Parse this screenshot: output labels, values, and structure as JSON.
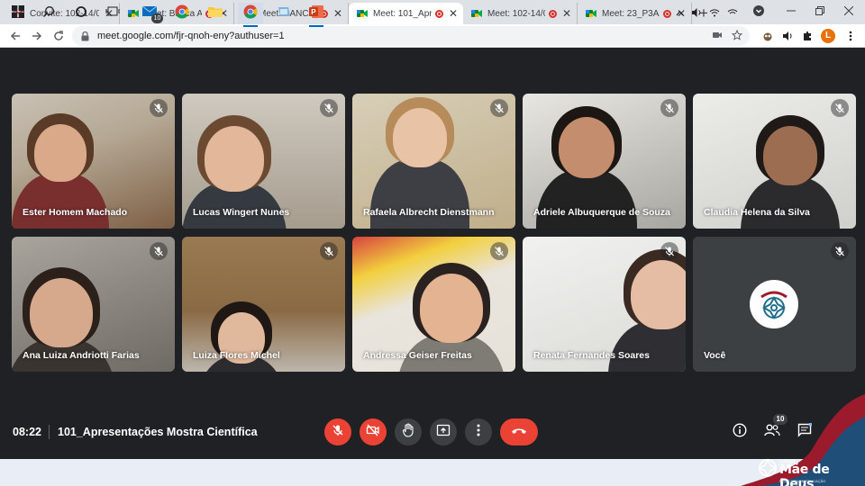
{
  "browser": {
    "tabs": [
      {
        "title": "Convite: 102-14/08",
        "favicon": "gmail-icon",
        "recording": false
      },
      {
        "title": "Meet: Banca Av",
        "favicon": "meet-icon",
        "recording": true
      },
      {
        "title": "Meet: BANCA_/",
        "favicon": "meet-icon",
        "recording": true
      },
      {
        "title": "Meet: 101_Apre",
        "favicon": "meet-icon",
        "recording": true,
        "active": true
      },
      {
        "title": "Meet: 102-14/0",
        "favicon": "meet-icon",
        "recording": true
      },
      {
        "title": "Meet: 23_P3A2",
        "favicon": "meet-icon",
        "recording": true
      }
    ],
    "url": "meet.google.com/fjr-qnoh-eny?authuser=1",
    "profile_initial": "L",
    "colors": {
      "profile": "#e8710a",
      "recording": "#d93025"
    }
  },
  "meet": {
    "participants": [
      {
        "name": "Ester Homem Machado",
        "muted": true
      },
      {
        "name": "Lucas Wingert Nunes",
        "muted": true
      },
      {
        "name": "Rafaela Albrecht Dienstmann",
        "muted": true
      },
      {
        "name": "Adriele Albuquerque de Souza",
        "muted": true
      },
      {
        "name": "Claudia Helena da Silva",
        "muted": true
      },
      {
        "name": "Ana Luiza Andriotti Farias",
        "muted": true
      },
      {
        "name": "Luiza Flores Michel",
        "muted": true
      },
      {
        "name": "Andressa Geiser Freitas",
        "muted": true
      },
      {
        "name": "Renata Fernandes Soares",
        "muted": true
      },
      {
        "name": "Você",
        "muted": true
      }
    ],
    "time": "08:22",
    "meeting_title": "101_Apresentações Mostra Científica",
    "participant_count": "10",
    "controls": [
      "mic-off-icon",
      "camera-off-icon",
      "raise-hand-icon",
      "present-icon",
      "more-icon",
      "hang-up-icon"
    ],
    "colors": {
      "background": "#202124",
      "danger": "#ea4335",
      "control": "#3c4043"
    }
  },
  "taskbar": {
    "mail_badge": "10",
    "apps": [
      "windows-icon",
      "search-icon",
      "cortana-icon",
      "task-view-icon",
      "mail-icon",
      "chrome-icon",
      "file-explorer-icon",
      "chrome-active-icon",
      "teams-icon",
      "powerpoint-icon"
    ]
  },
  "watermark": {
    "small": "Colégio",
    "brand": "Mãe de Deus",
    "tagline": "REDE SON DE EDUCAÇÃO"
  }
}
